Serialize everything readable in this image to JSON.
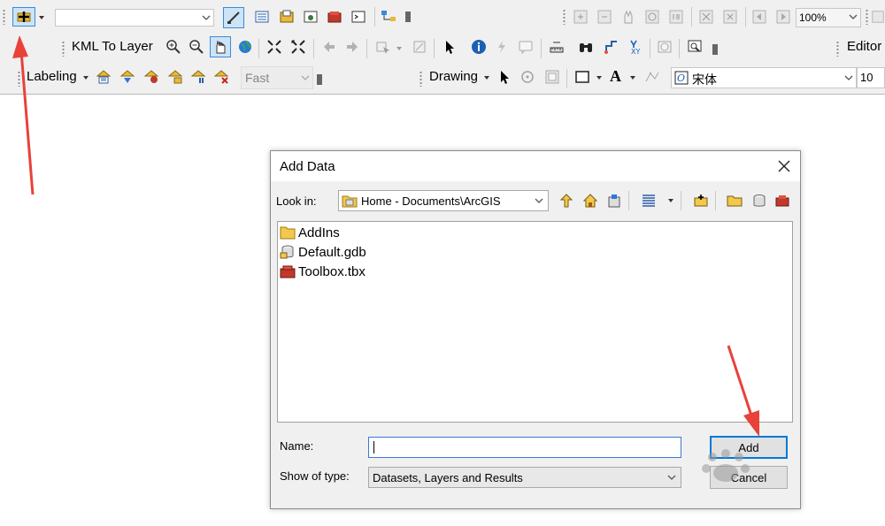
{
  "toolbar1": {
    "zoom_combo": "100%"
  },
  "toolbar2": {
    "kml_label": "KML To Layer",
    "editor_label": "Editor"
  },
  "toolbar3": {
    "labeling_label": "Labeling",
    "fast_combo": "Fast",
    "drawing_label": "Drawing",
    "text_glyph": "A",
    "font_combo": "宋体",
    "font_size": "10"
  },
  "dialog": {
    "title": "Add Data",
    "look_in_label": "Look in:",
    "look_in_value": "Home - Documents\\ArcGIS",
    "items": [
      {
        "name": "AddIns",
        "icon": "folder-icon"
      },
      {
        "name": "Default.gdb",
        "icon": "geodatabase-icon"
      },
      {
        "name": "Toolbox.tbx",
        "icon": "toolbox-icon"
      }
    ],
    "name_label": "Name:",
    "name_value": "",
    "type_label": "Show of type:",
    "type_value": "Datasets, Layers and Results",
    "add_button": "Add",
    "cancel_button": "Cancel"
  },
  "colors": {
    "arrow": "#e8423a",
    "accent": "#0078d7"
  }
}
